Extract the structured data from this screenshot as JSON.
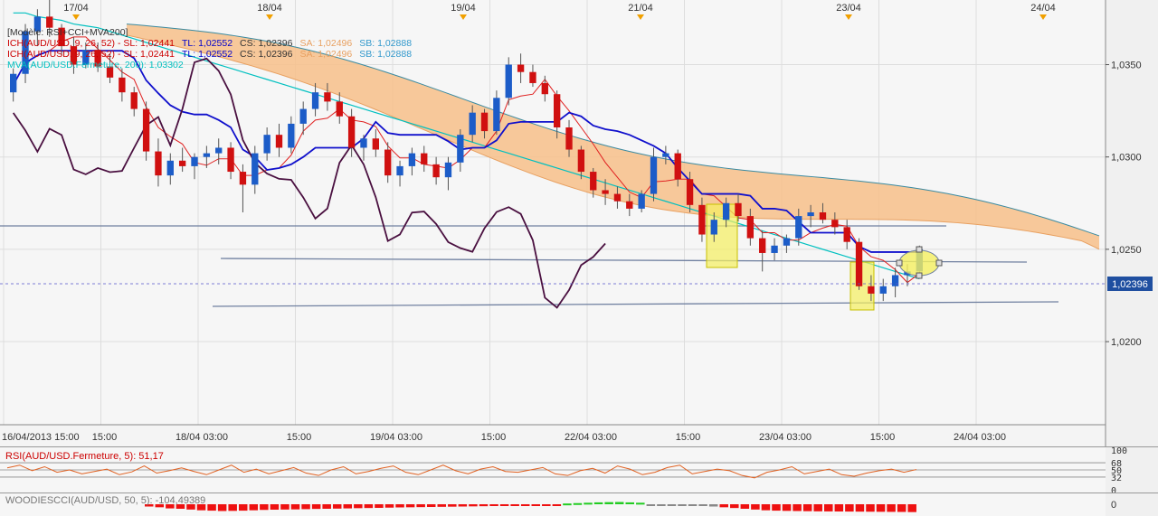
{
  "chart_data": {
    "type": "candlestick",
    "title": "[Modèle: RSI+CCI+MVA200]",
    "top_dates": [
      "17/04",
      "18/04",
      "19/04",
      "21/04",
      "23/04",
      "24/04"
    ],
    "x_ticks": [
      "16/04/2013 15:00",
      "15:00",
      "18/04 03:00",
      "15:00",
      "19/04 03:00",
      "15:00",
      "22/04 03:00",
      "15:00",
      "23/04 03:00",
      "15:00",
      "24/04 03:00"
    ],
    "y_ticks": [
      "1,0350",
      "1,0300",
      "1,0250",
      "1,0200"
    ],
    "y_range": [
      1.0155,
      1.0385
    ],
    "current_price": "1,02396",
    "current_value": 1.02396,
    "legend_lines": [
      {
        "text": "ICH(AUD/USD, 9, 26, 52) - SL: 1,02441",
        "color": "#cc0000"
      },
      {
        "text": "TL: 1,02552",
        "color": "#0000cc"
      },
      {
        "text": "CS: 1,02396",
        "color": "#333333"
      },
      {
        "text": "SA: 1,02496",
        "color": "#e8a060"
      },
      {
        "text": "SB: 1,02888",
        "color": "#3399cc"
      }
    ],
    "legend_mva": "MVA(AUD/USD.Fermeture, 200): 1,03302",
    "candles": [
      [
        1.0335,
        1.0348,
        1.033,
        1.0345
      ],
      [
        1.0345,
        1.0372,
        1.034,
        1.0368
      ],
      [
        1.0368,
        1.038,
        1.036,
        1.0376
      ],
      [
        1.0376,
        1.0385,
        1.0365,
        1.037
      ],
      [
        1.037,
        1.0372,
        1.0355,
        1.036
      ],
      [
        1.036,
        1.0365,
        1.0345,
        1.035
      ],
      [
        1.035,
        1.0362,
        1.0348,
        1.0358
      ],
      [
        1.0358,
        1.0362,
        1.0346,
        1.0349
      ],
      [
        1.0349,
        1.0356,
        1.034,
        1.0343
      ],
      [
        1.0343,
        1.0348,
        1.033,
        1.0335
      ],
      [
        1.0335,
        1.0338,
        1.0322,
        1.0326
      ],
      [
        1.0326,
        1.033,
        1.0298,
        1.0303
      ],
      [
        1.0303,
        1.031,
        1.0284,
        1.029
      ],
      [
        1.029,
        1.0302,
        1.0285,
        1.0298
      ],
      [
        1.0298,
        1.0305,
        1.0292,
        1.0295
      ],
      [
        1.0295,
        1.0302,
        1.0288,
        1.03
      ],
      [
        1.03,
        1.0306,
        1.0294,
        1.0302
      ],
      [
        1.0302,
        1.031,
        1.0296,
        1.0305
      ],
      [
        1.0305,
        1.0308,
        1.0288,
        1.0292
      ],
      [
        1.0292,
        1.0296,
        1.027,
        1.0285
      ],
      [
        1.0285,
        1.0306,
        1.028,
        1.0302
      ],
      [
        1.0302,
        1.0316,
        1.0298,
        1.0312
      ],
      [
        1.0312,
        1.0318,
        1.03,
        1.0305
      ],
      [
        1.0305,
        1.0322,
        1.0302,
        1.0318
      ],
      [
        1.0318,
        1.033,
        1.0312,
        1.0326
      ],
      [
        1.0326,
        1.034,
        1.0322,
        1.0335
      ],
      [
        1.0335,
        1.034,
        1.0325,
        1.033
      ],
      [
        1.033,
        1.0335,
        1.0318,
        1.0322
      ],
      [
        1.0322,
        1.0326,
        1.03,
        1.0305
      ],
      [
        1.0305,
        1.0312,
        1.0298,
        1.031
      ],
      [
        1.031,
        1.0315,
        1.03,
        1.0304
      ],
      [
        1.0304,
        1.0308,
        1.0286,
        1.029
      ],
      [
        1.029,
        1.0298,
        1.0284,
        1.0295
      ],
      [
        1.0295,
        1.0305,
        1.029,
        1.0302
      ],
      [
        1.0302,
        1.0306,
        1.0292,
        1.0296
      ],
      [
        1.0296,
        1.03,
        1.0285,
        1.0289
      ],
      [
        1.0289,
        1.03,
        1.0282,
        1.0297
      ],
      [
        1.0297,
        1.0315,
        1.0292,
        1.0312
      ],
      [
        1.0312,
        1.0328,
        1.0308,
        1.0324
      ],
      [
        1.0324,
        1.0326,
        1.031,
        1.0314
      ],
      [
        1.0314,
        1.0336,
        1.0312,
        1.0332
      ],
      [
        1.0332,
        1.0354,
        1.0328,
        1.035
      ],
      [
        1.035,
        1.0356,
        1.034,
        1.0346
      ],
      [
        1.0346,
        1.035,
        1.0338,
        1.034
      ],
      [
        1.034,
        1.0344,
        1.033,
        1.0334
      ],
      [
        1.0334,
        1.0336,
        1.031,
        1.0316
      ],
      [
        1.0316,
        1.032,
        1.03,
        1.0304
      ],
      [
        1.0304,
        1.0306,
        1.0288,
        1.0292
      ],
      [
        1.0292,
        1.0294,
        1.0278,
        1.0282
      ],
      [
        1.0282,
        1.0288,
        1.0274,
        1.028
      ],
      [
        1.028,
        1.0284,
        1.0272,
        1.0276
      ],
      [
        1.0276,
        1.028,
        1.0268,
        1.0272
      ],
      [
        1.0272,
        1.0282,
        1.027,
        1.028
      ],
      [
        1.028,
        1.0305,
        1.0276,
        1.03
      ],
      [
        1.03,
        1.0306,
        1.0296,
        1.0302
      ],
      [
        1.0302,
        1.0304,
        1.0284,
        1.0288
      ],
      [
        1.0288,
        1.0292,
        1.027,
        1.0274
      ],
      [
        1.0274,
        1.0278,
        1.0254,
        1.0258
      ],
      [
        1.0258,
        1.027,
        1.0254,
        1.0266
      ],
      [
        1.0266,
        1.0278,
        1.0262,
        1.0275
      ],
      [
        1.0275,
        1.028,
        1.0265,
        1.0268
      ],
      [
        1.0268,
        1.0272,
        1.0252,
        1.0256
      ],
      [
        1.0256,
        1.026,
        1.0238,
        1.0248
      ],
      [
        1.0248,
        1.0256,
        1.0244,
        1.0252
      ],
      [
        1.0252,
        1.0258,
        1.0248,
        1.0256
      ],
      [
        1.0256,
        1.0272,
        1.0252,
        1.0268
      ],
      [
        1.0268,
        1.0274,
        1.0262,
        1.027
      ],
      [
        1.027,
        1.0275,
        1.0264,
        1.0266
      ],
      [
        1.0266,
        1.027,
        1.0258,
        1.0262
      ],
      [
        1.0262,
        1.0266,
        1.025,
        1.0254
      ],
      [
        1.0254,
        1.0256,
        1.0228,
        1.023
      ],
      [
        1.023,
        1.0236,
        1.0222,
        1.0226
      ],
      [
        1.0226,
        1.0234,
        1.0222,
        1.023
      ],
      [
        1.023,
        1.024,
        1.0224,
        1.0236
      ],
      [
        1.0236,
        1.0242,
        1.023,
        1.0238
      ],
      [
        1.0238,
        1.0252,
        1.0236,
        1.025
      ]
    ],
    "mva200": [
      1.0372,
      1.0372,
      1.037,
      1.0369,
      1.0368,
      1.0366,
      1.0365,
      1.0364,
      1.0362,
      1.036,
      1.0358,
      1.0356,
      1.0354,
      1.0352,
      1.035,
      1.0348,
      1.0346,
      1.0344,
      1.0342,
      1.034,
      1.0338,
      1.0336,
      1.0334,
      1.0332,
      1.033,
      1.0328,
      1.0326,
      1.0324,
      1.0322,
      1.032,
      1.0318,
      1.0316,
      1.0314,
      1.0312,
      1.031,
      1.0308,
      1.0306,
      1.0304,
      1.0302,
      1.03,
      1.0298,
      1.0296,
      1.0294,
      1.0292,
      1.029,
      1.0288,
      1.0286,
      1.0284,
      1.0282,
      1.028,
      1.0278,
      1.0276,
      1.0274,
      1.0272,
      1.027,
      1.0268,
      1.0266,
      1.0264,
      1.0262,
      1.026,
      1.0258,
      1.0256,
      1.0254,
      1.0252,
      1.025,
      1.0248,
      1.0246,
      1.0244,
      1.0242,
      1.024,
      1.0238,
      1.0236,
      1.0234,
      1.0232,
      1.023,
      1.0228
    ],
    "rsi_label": "RSI(AUD/USD.Fermeture, 5): 51,17",
    "rsi_levels": [
      "100",
      "68",
      "50",
      "32",
      "0"
    ],
    "rsi_values": [
      55,
      62,
      48,
      58,
      44,
      50,
      40,
      46,
      52,
      38,
      45,
      60,
      42,
      48,
      55,
      46,
      38,
      50,
      62,
      44,
      52,
      40,
      48,
      56,
      42,
      36,
      50,
      58,
      40,
      46,
      54,
      60,
      44,
      38,
      50,
      62,
      48,
      40,
      52,
      58,
      46,
      44,
      50,
      56,
      40,
      36,
      48,
      54,
      42,
      60,
      52,
      38,
      44,
      56,
      62,
      40,
      46,
      52,
      48,
      36,
      30,
      44,
      50,
      58,
      40,
      46,
      52,
      38,
      34,
      42,
      48,
      52,
      44,
      51
    ],
    "cci_label": "WOODIESCCI(AUD/USD, 50, 5): -104,49389",
    "cci_level": "0",
    "cci_values": [
      -30,
      -40,
      -55,
      -60,
      -70,
      -80,
      -85,
      -90,
      -88,
      -85,
      -80,
      -75,
      -72,
      -70,
      -68,
      -65,
      -62,
      -60,
      -58,
      -55,
      -52,
      -50,
      -48,
      -45,
      -42,
      -40,
      -38,
      -36,
      -34,
      -32,
      -30,
      -28,
      -26,
      -24,
      -22,
      -20,
      -18,
      -16,
      -14,
      -12,
      10,
      15,
      20,
      25,
      28,
      30,
      25,
      20,
      -10,
      -12,
      -14,
      -16,
      -18,
      -20,
      -30,
      -40,
      -50,
      -60,
      -70,
      -80,
      -85,
      -88,
      -90,
      -92,
      -94,
      -95,
      -96,
      -97,
      -98,
      -99,
      -100,
      -101,
      -102,
      -104
    ]
  }
}
